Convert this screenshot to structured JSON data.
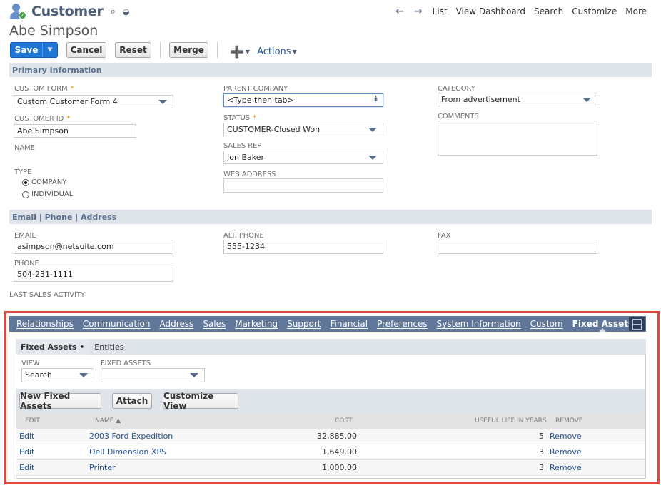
{
  "header": {
    "record_type": "Customer",
    "record_name": "Abe Simpson",
    "nav": {
      "back_icon": "arrow-left-icon",
      "forward_icon": "arrow-right-icon",
      "links": [
        "List",
        "View Dashboard",
        "Search",
        "Customize",
        "More"
      ]
    }
  },
  "toolbar": {
    "save": "Save",
    "cancel": "Cancel",
    "reset": "Reset",
    "merge": "Merge",
    "actions": "Actions"
  },
  "primary": {
    "title": "Primary Information",
    "custom_form": {
      "label": "CUSTOM FORM",
      "value": "Custom Customer Form 4"
    },
    "customer_id": {
      "label": "CUSTOMER ID",
      "value": "Abe Simpson"
    },
    "name": {
      "label": "NAME"
    },
    "type": {
      "label": "TYPE",
      "options": [
        "COMPANY",
        "INDIVIDUAL"
      ],
      "selected": "COMPANY"
    },
    "parent_company": {
      "label": "PARENT COMPANY",
      "value": "<Type then tab>"
    },
    "status": {
      "label": "STATUS",
      "value": "CUSTOMER-Closed Won"
    },
    "sales_rep": {
      "label": "SALES REP",
      "value": "Jon Baker"
    },
    "web_address": {
      "label": "WEB ADDRESS",
      "value": ""
    },
    "category": {
      "label": "CATEGORY",
      "value": "From advertisement"
    },
    "comments": {
      "label": "COMMENTS",
      "value": ""
    },
    "required_mark": "*"
  },
  "contact": {
    "title": "Email | Phone | Address",
    "email": {
      "label": "EMAIL",
      "value": "asimpson@netsuite.com"
    },
    "phone": {
      "label": "PHONE",
      "value": "504-231-1111"
    },
    "alt_phone": {
      "label": "ALT. PHONE",
      "value": "555-1234"
    },
    "fax": {
      "label": "FAX",
      "value": ""
    },
    "last_sales_activity": {
      "label": "LAST SALES ACTIVITY"
    }
  },
  "tabs": [
    "Relationships",
    "Communication",
    "Address",
    "Sales",
    "Marketing",
    "Support",
    "Financial",
    "Preferences",
    "System Information",
    "Custom",
    "Fixed Assets"
  ],
  "active_tab": "Fixed Assets",
  "subtabs": [
    "Fixed Assets •",
    "Entities"
  ],
  "fixed_assets": {
    "view": {
      "label": "VIEW",
      "value": "Search"
    },
    "filter": {
      "label": "FIXED ASSETS",
      "value": ""
    },
    "buttons": [
      "New Fixed Assets",
      "Attach",
      "Customize View"
    ],
    "columns": [
      "EDIT",
      "NAME ▲",
      "COST",
      "USEFUL LIFE IN YEARS",
      "REMOVE"
    ],
    "rows": [
      {
        "edit": "Edit",
        "name": "2003 Ford Expedition",
        "cost": "32,885.00",
        "life": "5",
        "remove": "Remove"
      },
      {
        "edit": "Edit",
        "name": "Dell Dimension XPS",
        "cost": "1,649.00",
        "life": "3",
        "remove": "Remove"
      },
      {
        "edit": "Edit",
        "name": "Printer",
        "cost": "1,000.00",
        "life": "3",
        "remove": "Remove"
      }
    ]
  },
  "colors": {
    "accent_blue": "#1e77d4",
    "tab_bar": "#607799",
    "section_bg": "#dfe4eb",
    "highlight_border": "#e0463c",
    "link": "#255599"
  }
}
